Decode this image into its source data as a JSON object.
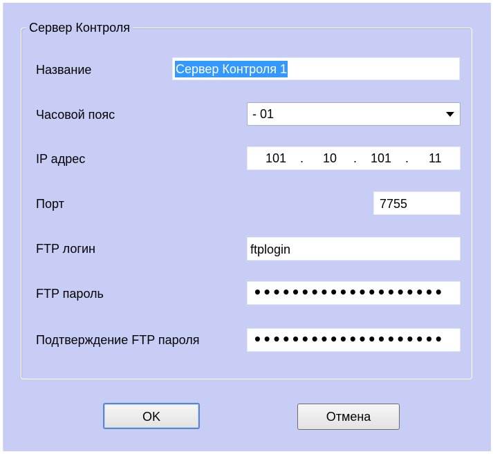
{
  "group": {
    "title": "Сервер Контроля"
  },
  "fields": {
    "name": {
      "label": "Название",
      "value": "Сервер Контроля 1"
    },
    "timezone": {
      "label": "Часовой пояс",
      "value": "- 01"
    },
    "ip": {
      "label": "IP адрес",
      "octets": [
        "101",
        "10",
        "101",
        "11"
      ]
    },
    "port": {
      "label": "Порт",
      "value": "7755"
    },
    "ftp_login": {
      "label": "FTP логин",
      "value": "ftplogin"
    },
    "ftp_password": {
      "label": "FTP пароль",
      "value": "••••••••••••••••••••"
    },
    "ftp_password_confirm": {
      "label": "Подтверждение FTP пароля",
      "value": "••••••••••••••••••••"
    }
  },
  "buttons": {
    "ok": "OK",
    "cancel": "Отмена"
  },
  "colors": {
    "panel_bg": "#c8cdf5",
    "selection": "#3399ff",
    "default_button_border": "#5b86c8"
  }
}
